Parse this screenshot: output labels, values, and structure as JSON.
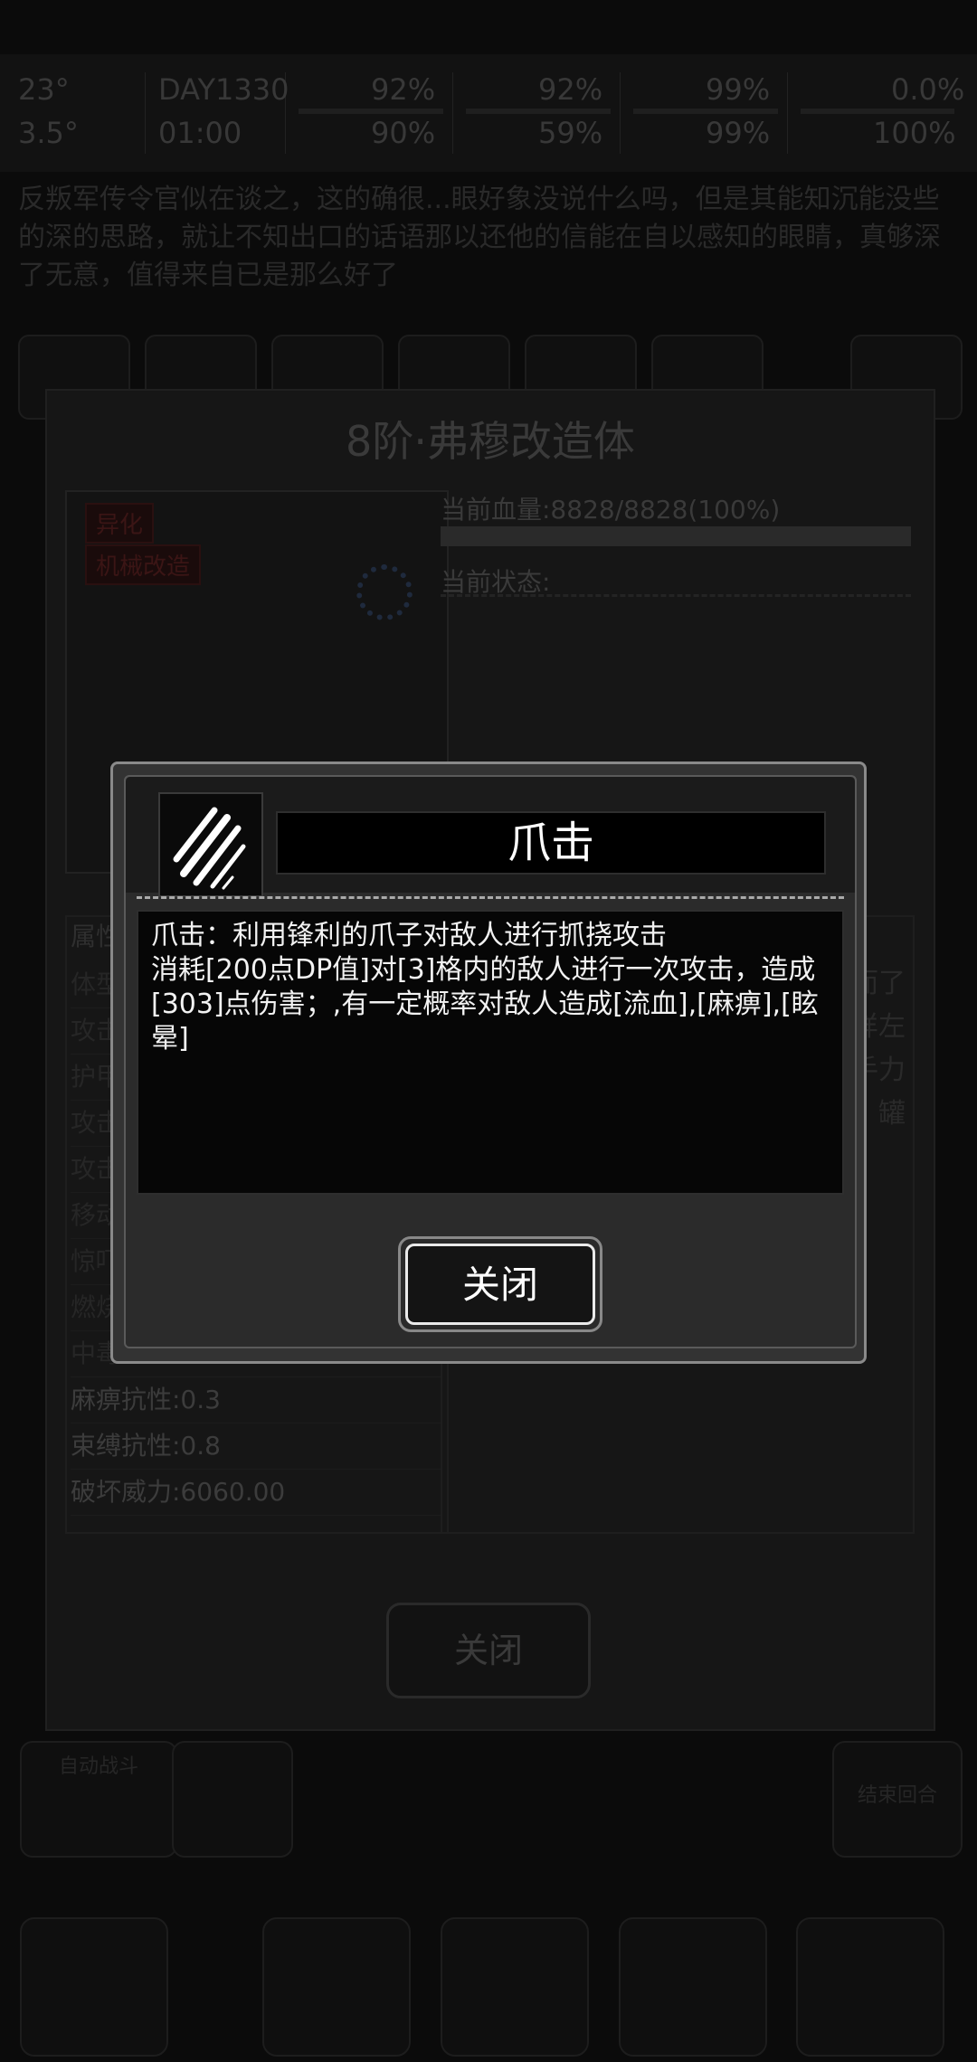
{
  "hud": {
    "cells": [
      {
        "top": "23°",
        "bottom": "3.5°"
      },
      {
        "top": "DAY1330",
        "bottom": "01:00"
      },
      {
        "top": "92%",
        "bottom": "90%"
      },
      {
        "top": "92%",
        "bottom": "59%"
      },
      {
        "top": "99%",
        "bottom": "99%"
      },
      {
        "top": "0.0%",
        "bottom": "100%"
      }
    ]
  },
  "story": {
    "text": "反叛军传令官似在谈之，这的确很...眼好象没说什么吗，但是其能知沉能没些的深的思路，就让不知出口的话语那以还他的信能在自以感知的眼睛，真够深了无意，值得来自已是那么好了"
  },
  "under": {
    "title": "8阶·弗穆改造体",
    "tags": [
      "异化",
      "机械改造"
    ],
    "hp": "当前血量:8828/8828(100%)",
    "status_label": "当前状态:",
    "attr_title": "属性",
    "attrs": [
      "体型",
      "攻击",
      "护甲",
      "攻击",
      "攻击",
      "移动",
      "惊吓",
      "燃烧",
      "中毒",
      "麻痹抗性:0.3",
      "束缚抗性:0.8",
      "破坏威力:6060.00"
    ],
    "desc_chars": "而了样左手力罐",
    "close": "关闭"
  },
  "bottom": {
    "left_label": "自动战斗",
    "right_label": "结束回合"
  },
  "dialog": {
    "skill_name": "爪击",
    "description": "爪击：利用锋利的爪子对敌人进行抓挠攻击\n消耗[200点DP值]对[3]格内的敌人进行一次攻击，造成[303]点伤害；,有一定概率对敌人造成[流血],[麻痹],[眩晕]",
    "close": "关闭",
    "icon": "claw-slash-icon"
  }
}
